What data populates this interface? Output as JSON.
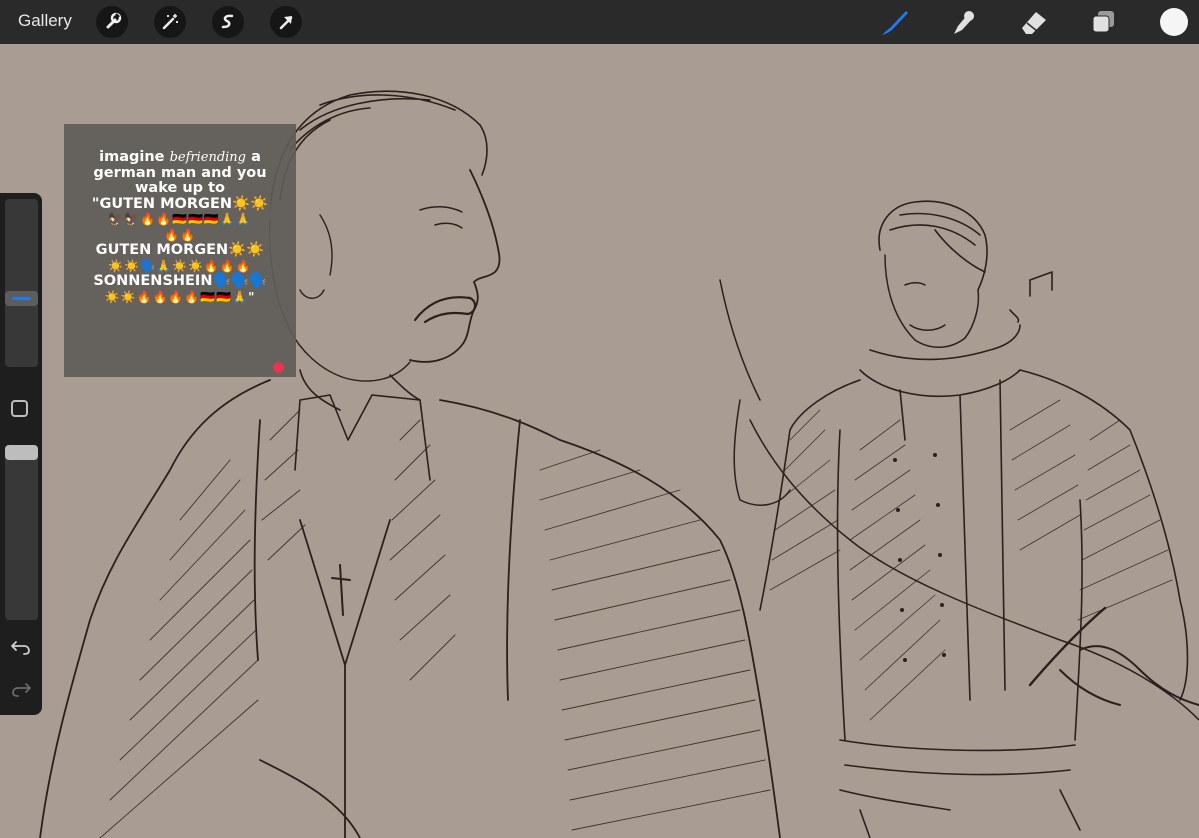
{
  "toolbar": {
    "gallery_label": "Gallery",
    "left_tools": [
      {
        "icon": "wrench-icon",
        "label": "Actions"
      },
      {
        "icon": "magic-wand-icon",
        "label": "Adjustments"
      },
      {
        "icon": "selection-icon",
        "label": "Selection"
      },
      {
        "icon": "transform-arrow-icon",
        "label": "Transform"
      }
    ],
    "right_tools": [
      {
        "icon": "brush-icon",
        "state": "active"
      },
      {
        "icon": "smudge-icon"
      },
      {
        "icon": "eraser-icon"
      },
      {
        "icon": "layers-icon"
      }
    ],
    "current_color": "#f5f5f5",
    "active_color": "#1e7cf0"
  },
  "sidebar": {
    "brush_size": 0.4,
    "opacity": 1.0,
    "undo_icon": "undo-icon",
    "redo_icon": "redo-icon",
    "modify_icon": "square-modify-icon"
  },
  "meme": {
    "line1_pre": "imagine ",
    "line1_script": "befriending",
    "line1_post": " a",
    "line2": "german man and you",
    "line3": "wake up to",
    "line4": "\"GUTEN MORGEN☀️☀️",
    "line5": "🦅🦅🔥🔥🇩🇪🇩🇪🇩🇪🙏🙏",
    "line6": "🔥🔥",
    "line7": "GUTEN MORGEN☀️☀️",
    "line8": "☀️☀️🗣️🙏☀️☀️🔥🔥🔥",
    "line9": "SONNENSHEIN🗣️🗣️🗣️",
    "line10": "☀️☀️🔥🔥🔥🔥🇩🇪🇩🇪🙏\""
  },
  "colors": {
    "canvas": "#a89c93",
    "ink": "#2e1f1c",
    "panel": "#1e1e1e"
  }
}
